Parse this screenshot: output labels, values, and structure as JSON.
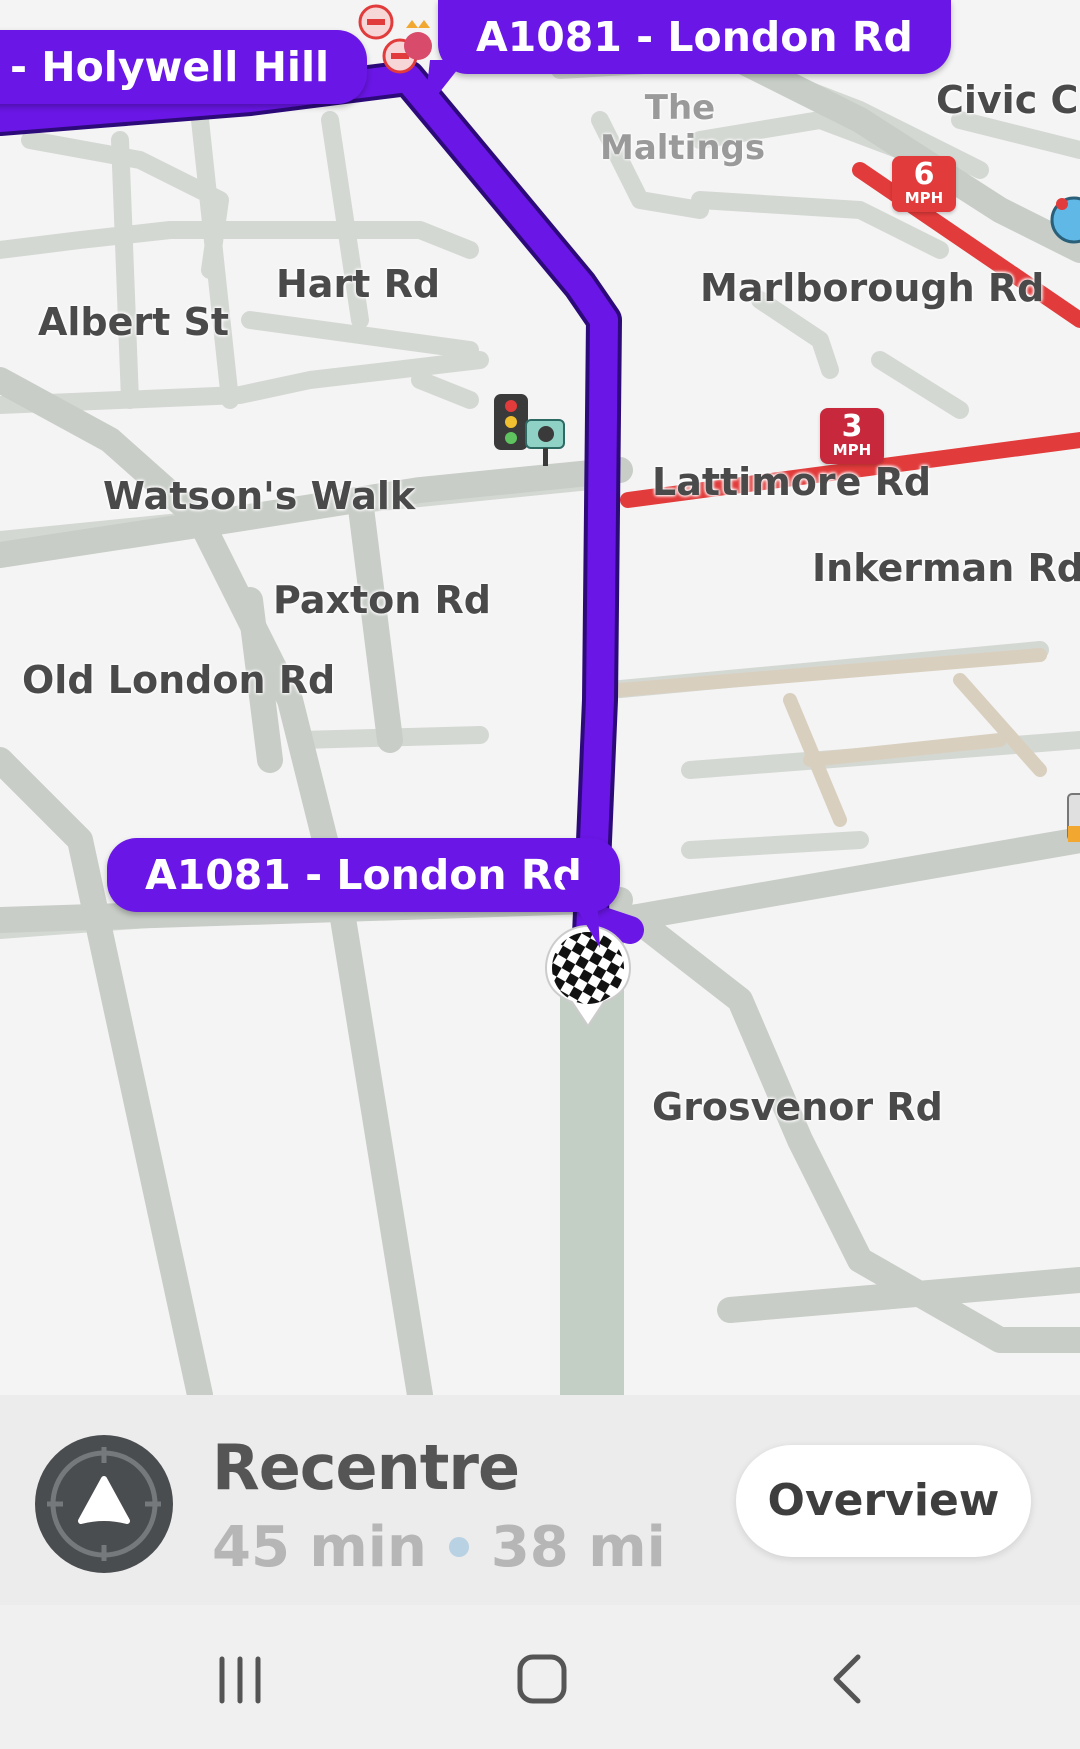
{
  "map": {
    "callouts": {
      "top_left": "- Holywell Hill",
      "top_right": "A1081 - London Rd",
      "bottom": "A1081 - London Rd"
    },
    "road_labels": {
      "hart": "Hart Rd",
      "albert": "Albert St",
      "marlborough": "Marlborough Rd",
      "civic": "Civic Cl",
      "watsons": "Watson's Walk",
      "lattimore": "Lattimore Rd",
      "inkerman": "Inkerman Rd",
      "paxton": "Paxton Rd",
      "old_london": "Old London Rd",
      "grosvenor": "Grosvenor Rd"
    },
    "poi_labels": {
      "maltings_line1": "The",
      "maltings_line2": "Maltings"
    },
    "speed_badges": {
      "badge1": {
        "value": "6",
        "unit": "MPH"
      },
      "badge2": {
        "value": "3",
        "unit": "MPH"
      }
    },
    "colors": {
      "route": "#6a16e6",
      "traffic": "#e23b3b"
    }
  },
  "bottom_panel": {
    "recenter_label": "Recentre",
    "eta_time": "45 min",
    "eta_distance": "38 mi",
    "overview_label": "Overview"
  }
}
